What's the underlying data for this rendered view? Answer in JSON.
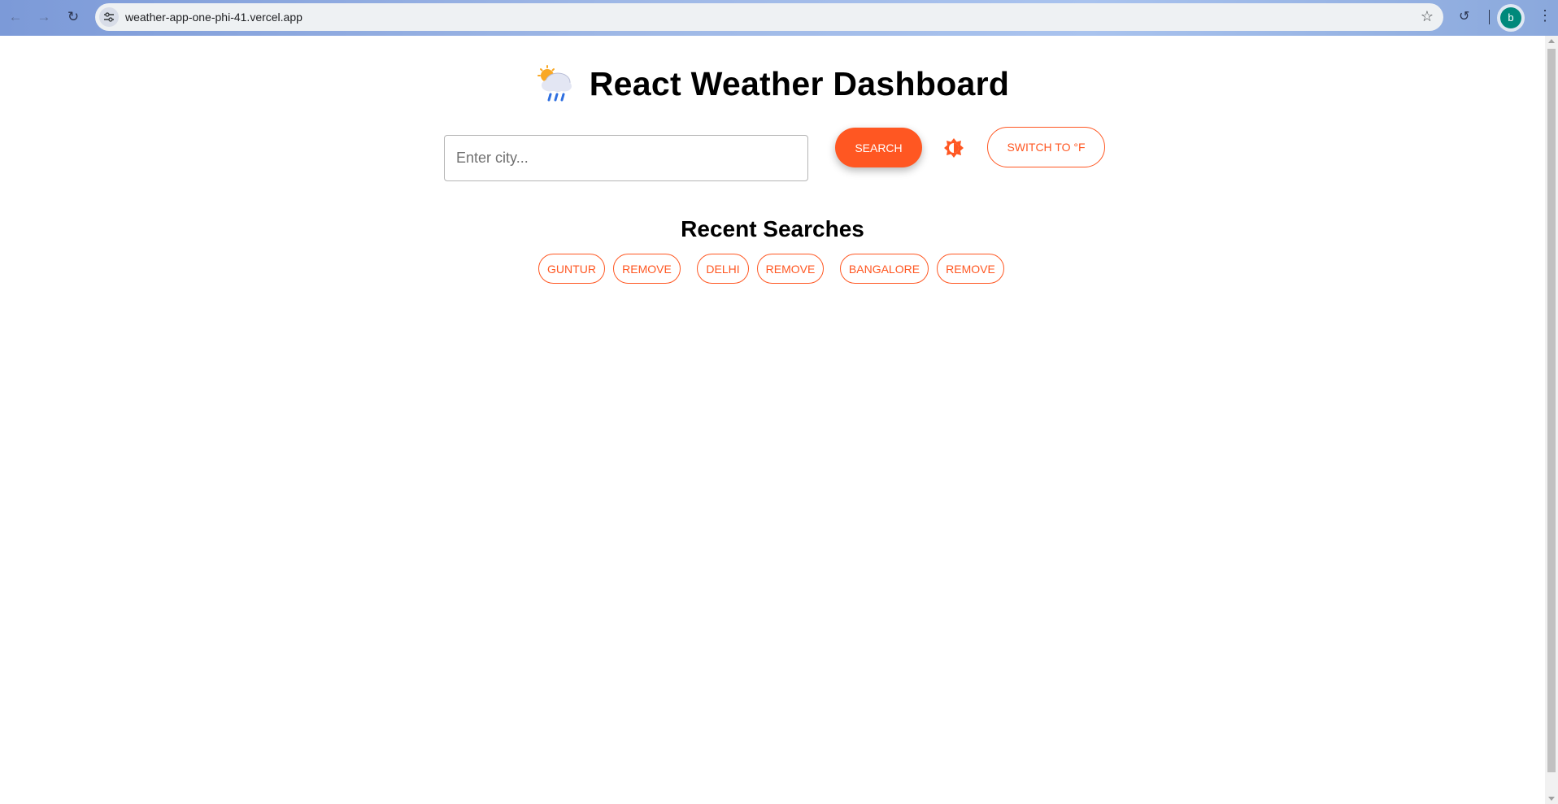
{
  "browser": {
    "url": "weather-app-one-phi-41.vercel.app",
    "profile_initial": "b"
  },
  "app": {
    "title": "React Weather Dashboard",
    "title_icon": "cloud-sun-rain-icon",
    "search": {
      "placeholder": "Enter city...",
      "value": "",
      "button_label": "SEARCH"
    },
    "theme_toggle_icon": "brightness-icon",
    "unit_toggle_label": "SWITCH TO °F",
    "recent": {
      "heading": "Recent Searches",
      "items": [
        {
          "city": "GUNTUR",
          "remove_label": "REMOVE"
        },
        {
          "city": "DELHI",
          "remove_label": "REMOVE"
        },
        {
          "city": "BANGALORE",
          "remove_label": "REMOVE"
        }
      ]
    }
  },
  "colors": {
    "accent": "#ff5722"
  }
}
